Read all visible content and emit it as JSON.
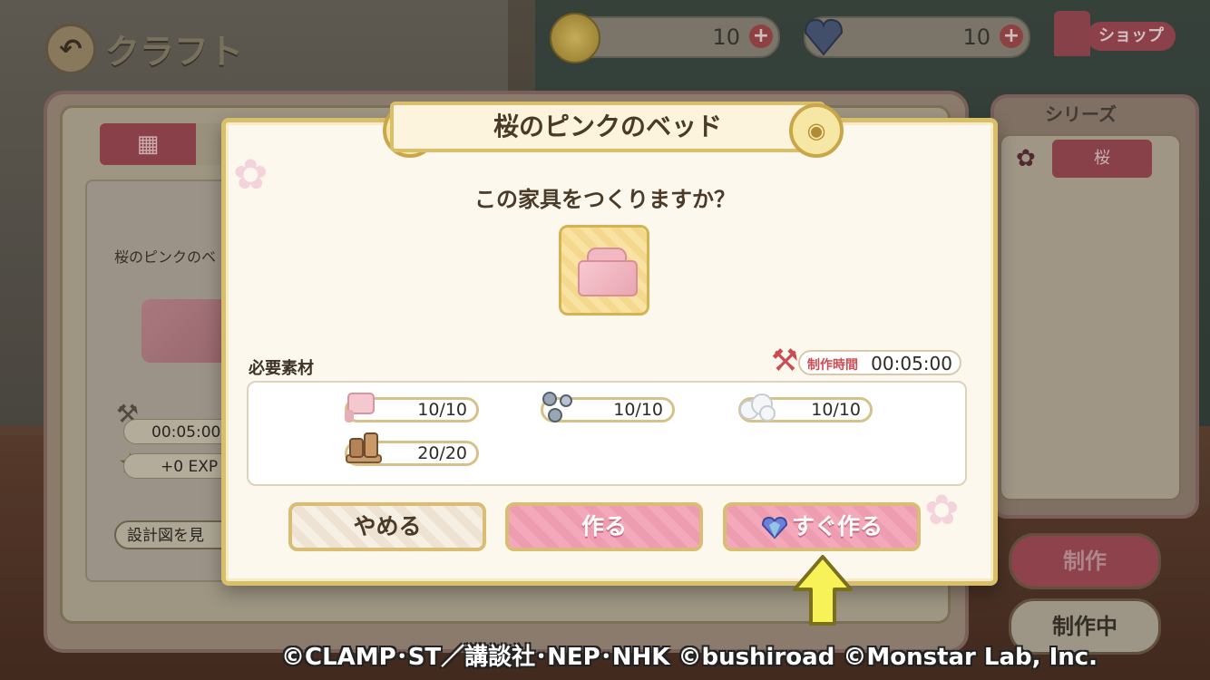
{
  "header": {
    "title": "クラフト",
    "back_icon": "back-arrow-icon"
  },
  "currency": {
    "coins": {
      "value": "10",
      "icon": "coin-icon",
      "plus": "+"
    },
    "gems": {
      "value": "10",
      "icon": "heart-gem-icon",
      "plus": "+"
    }
  },
  "shop": {
    "label": "ショップ",
    "icon": "shop-icon"
  },
  "left_panel": {
    "grid_tab_icon": "grid-icon",
    "card": {
      "name": "桜のピンクのベ",
      "time": "00:05:00",
      "exp": "+0 EXP",
      "blueprint_label": "設計図を見"
    }
  },
  "series": {
    "title": "シリーズ",
    "items": [
      {
        "label": "桜",
        "icon": "sakura-icon"
      }
    ]
  },
  "side_buttons": {
    "make": "制作",
    "in_progress": "制作中"
  },
  "dialog": {
    "title": "桜のピンクのベッド",
    "question": "この家具をつくりますか？",
    "required_label": "必要素材",
    "time_label": "制作時間",
    "time_value": "00:05:00",
    "materials": [
      {
        "name": "fabric-roll-icon",
        "count": "10/10"
      },
      {
        "name": "screws-icon",
        "count": "10/10"
      },
      {
        "name": "cotton-icon",
        "count": "10/10"
      },
      {
        "name": "wood-log-icon",
        "count": "20/20"
      }
    ],
    "buttons": {
      "cancel": "やめる",
      "make": "作る",
      "instant": "すぐ作る"
    }
  },
  "copyright": "©CLAMP･ST／講談社･NEP･NHK ©bushiroad ©Monstar Lab, Inc.",
  "colors": {
    "accent_pink": "#ee9caf",
    "gold": "#d9bf6a",
    "dialog_bg": "#fdf8ee"
  }
}
